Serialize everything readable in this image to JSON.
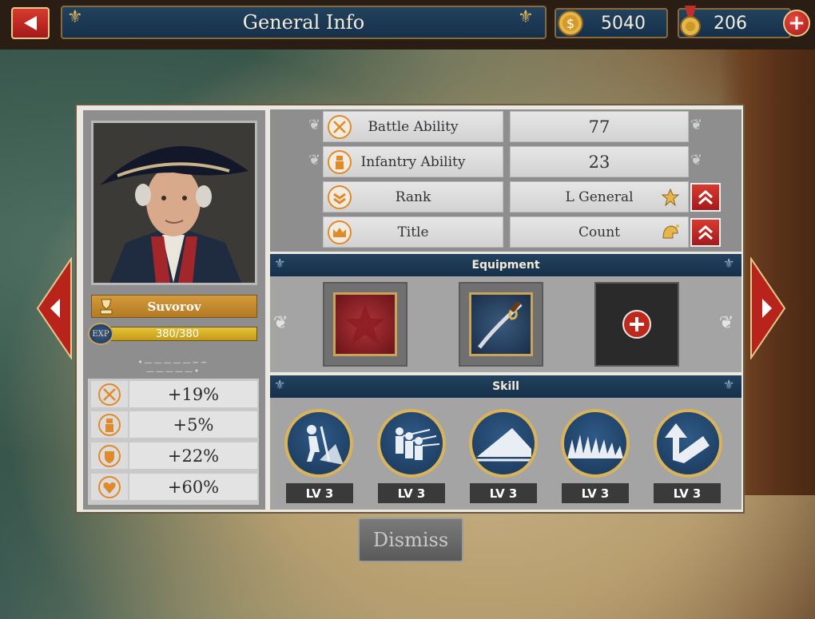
{
  "header": {
    "title": "General Info",
    "gold": "5040",
    "medals": "206"
  },
  "general": {
    "name": "Suvorov",
    "exp_label": "EXP",
    "exp_text": "380/380",
    "exp_fraction": 1.0
  },
  "bonuses": [
    {
      "icon": "crossed-swords-icon",
      "value": "+19%"
    },
    {
      "icon": "infantry-icon",
      "value": "+5%"
    },
    {
      "icon": "shield-icon",
      "value": "+22%"
    },
    {
      "icon": "heart-icon",
      "value": "+60%"
    }
  ],
  "stats": [
    {
      "label": "Battle Ability",
      "value": "77",
      "icon": "crossed-swords-icon"
    },
    {
      "label": "Infantry Ability",
      "value": "23",
      "icon": "infantry-icon"
    },
    {
      "label": "Rank",
      "value": "L General",
      "icon": "rank-chevron-icon",
      "badge": "star-icon"
    },
    {
      "label": "Title",
      "value": "Count",
      "icon": "crown-icon",
      "badge": "helmet-icon"
    }
  ],
  "equipment": {
    "header": "Equipment",
    "slots": [
      "red-emblem-item",
      "saber-item",
      "add-equipment-slot"
    ]
  },
  "skill": {
    "header": "Skill",
    "skills": [
      {
        "icon": "infantry-charge-icon",
        "level": "LV 3"
      },
      {
        "icon": "musket-volley-icon",
        "level": "LV 3"
      },
      {
        "icon": "ramp-icon",
        "level": "LV 3"
      },
      {
        "icon": "spikes-icon",
        "level": "LV 3"
      },
      {
        "icon": "bugle-icon",
        "level": "LV 3"
      }
    ]
  },
  "actions": {
    "dismiss": "Dismiss"
  },
  "colors": {
    "navy": "#16304a",
    "gold": "#d8b35a",
    "red": "#a5191c",
    "orange_icon": "#e08a2a"
  }
}
